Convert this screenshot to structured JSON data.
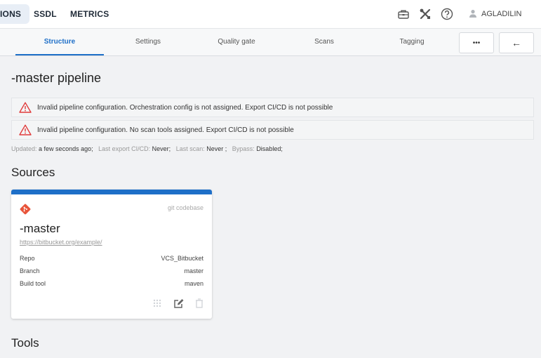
{
  "nav": {
    "items": [
      {
        "label": "IONS"
      },
      {
        "label": "SSDL"
      },
      {
        "label": "METRICS"
      }
    ],
    "icons": [
      "toolbox-icon",
      "tools-icon",
      "help-icon"
    ],
    "user": {
      "name": "AGLADILIN",
      "icon": "user-icon"
    }
  },
  "tabs": {
    "items": [
      {
        "label": "Structure"
      },
      {
        "label": "Settings"
      },
      {
        "label": "Quality gate"
      },
      {
        "label": "Scans"
      },
      {
        "label": "Tagging"
      }
    ],
    "more_label": "•••",
    "back_label": "←"
  },
  "page": {
    "title": "-master pipeline",
    "alerts": [
      {
        "text": "Invalid pipeline configuration. Orchestration config is not assigned. Export CI/CD is not possible"
      },
      {
        "text": "Invalid pipeline configuration. No scan tools assigned. Export CI/CD is not possible"
      }
    ],
    "meta": {
      "updated_label": "Updated:",
      "updated_value": "a few seconds ago;",
      "export_label": "Last export CI/CD:",
      "export_value": "Never;",
      "scan_label": "Last scan:",
      "scan_value": "Never ;",
      "bypass_label": "Bypass:",
      "bypass_value": "Disabled;"
    }
  },
  "sources": {
    "title": "Sources",
    "card": {
      "type": "git codebase",
      "name": "-master",
      "url": "https://bitbucket.org/example/",
      "rows": [
        {
          "label": "Repo",
          "value": "VCS_Bitbucket"
        },
        {
          "label": "Branch",
          "value": "master"
        },
        {
          "label": "Build tool",
          "value": "maven"
        }
      ],
      "accent": "#1e6fc8",
      "logo_color": "#e8543a"
    }
  },
  "tools": {
    "title": "Tools"
  },
  "colors": {
    "accent": "#1e6fc8",
    "warning": "#e03a3a"
  }
}
